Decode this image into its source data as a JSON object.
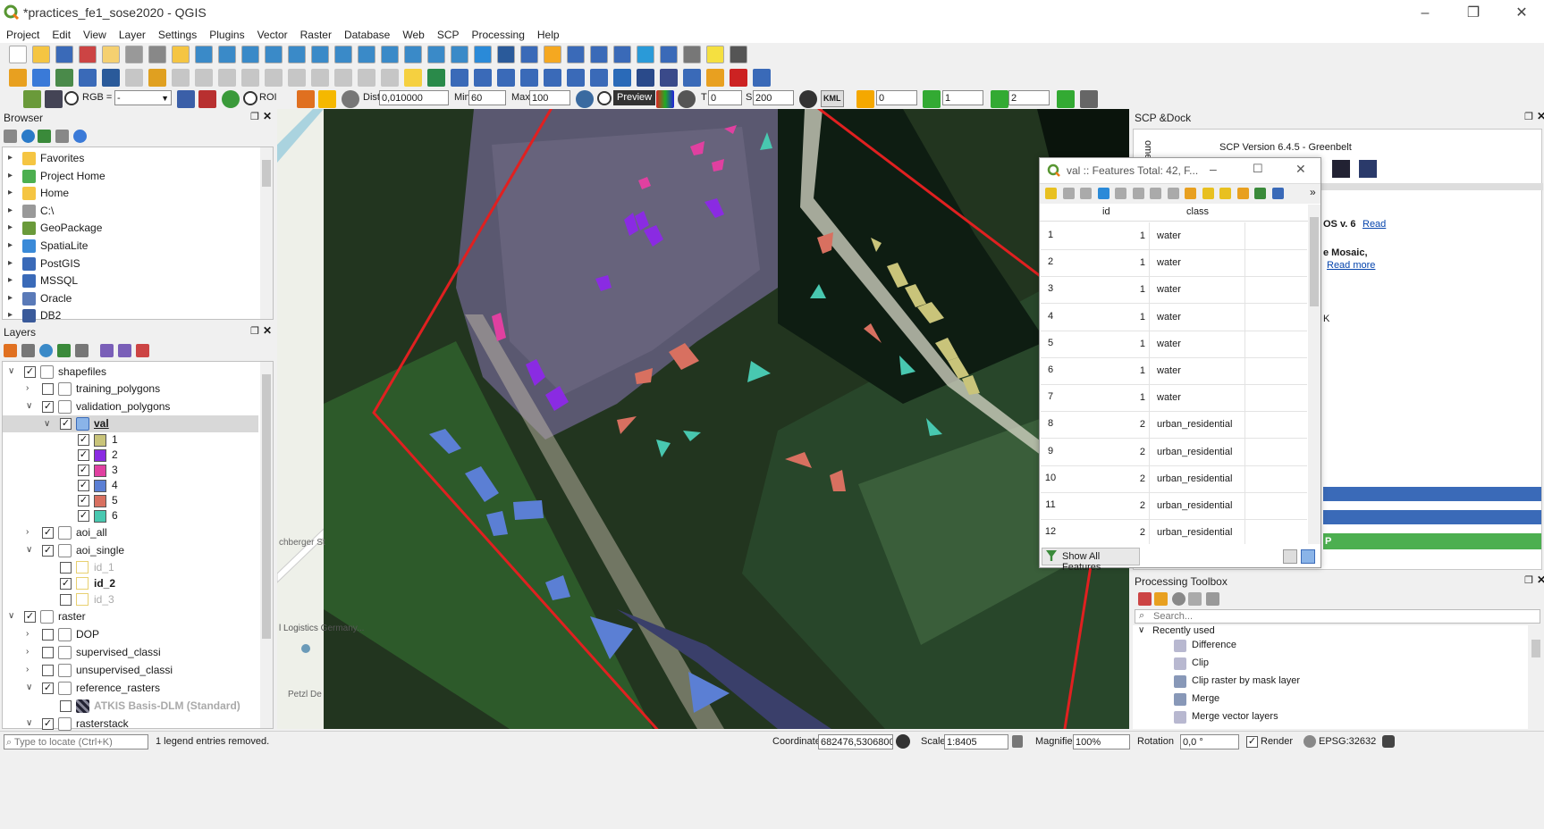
{
  "window": {
    "title": "*practices_fe1_sose2020 - QGIS"
  },
  "menu": [
    "Project",
    "Edit",
    "View",
    "Layer",
    "Settings",
    "Plugins",
    "Vector",
    "Raster",
    "Database",
    "Web",
    "SCP",
    "Processing",
    "Help"
  ],
  "scp_toolbar": {
    "rgb_label": "RGB =",
    "rgb_value": "-",
    "roi_label": "ROI",
    "dist_label": "Dist",
    "dist_value": "0,010000",
    "min_label": "Min",
    "min_value": "60",
    "max_label": "Max",
    "max_value": "100",
    "preview_label": "Preview",
    "t_label": "T",
    "t_value": "0",
    "s_label": "S",
    "s_value": "200",
    "kml_label": "KML",
    "spin1": "0",
    "spin2": "1",
    "spin3": "2"
  },
  "browser": {
    "title": "Browser",
    "items": [
      "Favorites",
      "Project Home",
      "Home",
      "C:\\",
      "GeoPackage",
      "SpatiaLite",
      "PostGIS",
      "MSSQL",
      "Oracle",
      "DB2"
    ]
  },
  "layers": {
    "title": "Layers",
    "rows": [
      {
        "label": "shapefiles"
      },
      {
        "label": "training_polygons"
      },
      {
        "label": "validation_polygons"
      },
      {
        "label": "val"
      },
      {
        "label": "1"
      },
      {
        "label": "2"
      },
      {
        "label": "3"
      },
      {
        "label": "4"
      },
      {
        "label": "5"
      },
      {
        "label": "6"
      },
      {
        "label": "aoi_all"
      },
      {
        "label": "aoi_single"
      },
      {
        "label": "id_1"
      },
      {
        "label": "id_2"
      },
      {
        "label": "id_3"
      },
      {
        "label": "raster"
      },
      {
        "label": "DOP"
      },
      {
        "label": "supervised_classi"
      },
      {
        "label": "unsupervised_classi"
      },
      {
        "label": "reference_rasters"
      },
      {
        "label": "ATKIS Basis-DLM (Standard)"
      },
      {
        "label": "rasterstack"
      }
    ],
    "class_colors": [
      "#c9c47a",
      "#8a2be2",
      "#e040a0",
      "#5b7fd4",
      "#d87060",
      "#48c8b0"
    ]
  },
  "map": {
    "labels": [
      "chberger St",
      "l Logistics\nGermany...",
      "Petzl De"
    ]
  },
  "scp_dock": {
    "title": "SCP &Dock",
    "version": "SCP Version 6.4.5 - Greenbelt",
    "tab": "ome",
    "line1": "OS v. 6",
    "link1": "Read",
    "line2": "e Mosaic,",
    "link2": "Read more",
    "k": "K",
    "btn_p": "P"
  },
  "attr_table": {
    "title": "val :: Features Total: 42, F...",
    "col_id": "id",
    "col_class": "class",
    "rows": [
      {
        "n": "1",
        "id": "1",
        "cls": "water"
      },
      {
        "n": "2",
        "id": "1",
        "cls": "water"
      },
      {
        "n": "3",
        "id": "1",
        "cls": "water"
      },
      {
        "n": "4",
        "id": "1",
        "cls": "water"
      },
      {
        "n": "5",
        "id": "1",
        "cls": "water"
      },
      {
        "n": "6",
        "id": "1",
        "cls": "water"
      },
      {
        "n": "7",
        "id": "1",
        "cls": "water"
      },
      {
        "n": "8",
        "id": "2",
        "cls": "urban_residential"
      },
      {
        "n": "9",
        "id": "2",
        "cls": "urban_residential"
      },
      {
        "n": "10",
        "id": "2",
        "cls": "urban_residential"
      },
      {
        "n": "11",
        "id": "2",
        "cls": "urban_residential"
      },
      {
        "n": "12",
        "id": "2",
        "cls": "urban_residential"
      }
    ],
    "show_all": "Show All Features"
  },
  "toolbox": {
    "title": "Processing Toolbox",
    "search_placeholder": "Search...",
    "group": "Recently used",
    "items": [
      "Difference",
      "Clip",
      "Clip raster by mask layer",
      "Merge",
      "Merge vector layers"
    ]
  },
  "status": {
    "locate_placeholder": "Type to locate (Ctrl+K)",
    "message": "1 legend entries removed.",
    "coordinate_label": "Coordinate",
    "coordinate_value": "682476,5306800",
    "scale_label": "Scale",
    "scale_value": "1:8405",
    "magnifier_label": "Magnifier",
    "magnifier_value": "100%",
    "rotation_label": "Rotation",
    "rotation_value": "0,0 °",
    "render_label": "Render",
    "crs": "EPSG:32632"
  }
}
